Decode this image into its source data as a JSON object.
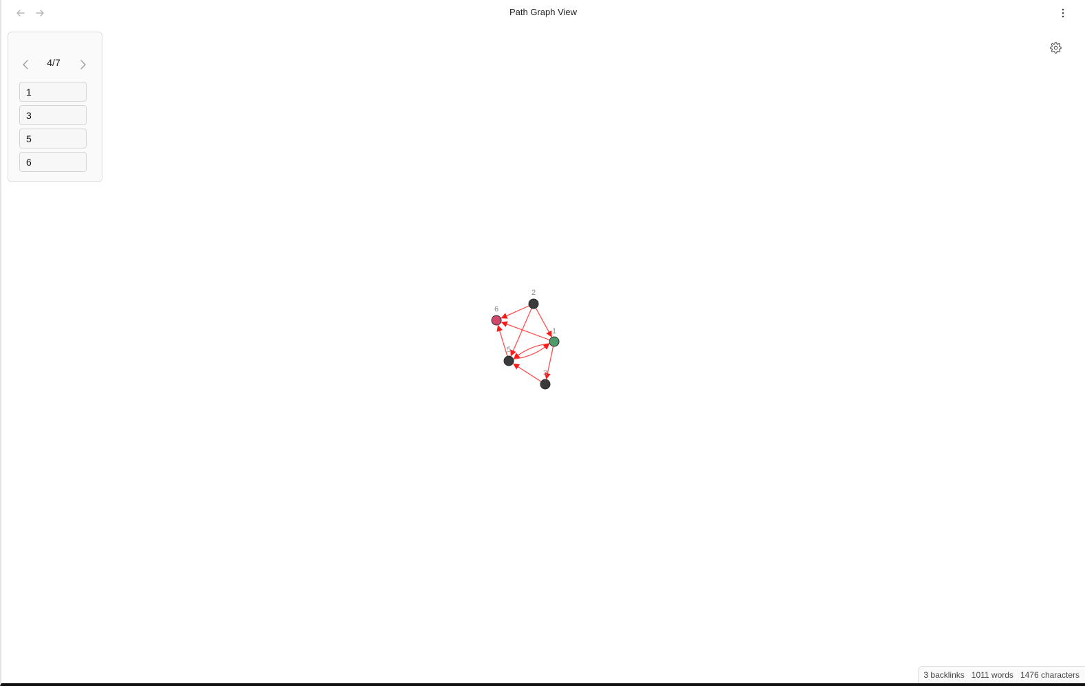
{
  "header": {
    "title": "Path Graph View"
  },
  "path_panel": {
    "pager": "4/7",
    "items": [
      {
        "label": "1"
      },
      {
        "label": "3"
      },
      {
        "label": "5"
      },
      {
        "label": "6"
      }
    ]
  },
  "graph": {
    "node_color_default": "#3a3a3a",
    "node_color_start": "#4e9a6a",
    "node_color_end": "#d0486a",
    "edge_color": "#ff4d4d",
    "label_color": "#8a8a8a",
    "nodes": [
      {
        "id": "1",
        "label": "1",
        "role": "start"
      },
      {
        "id": "2",
        "label": "2",
        "role": "default"
      },
      {
        "id": "3",
        "label": "3",
        "role": "default"
      },
      {
        "id": "5",
        "label": "5",
        "role": "default"
      },
      {
        "id": "6",
        "label": "6",
        "role": "end"
      }
    ],
    "edges": [
      {
        "from": "2",
        "to": "6"
      },
      {
        "from": "2",
        "to": "1"
      },
      {
        "from": "2",
        "to": "5"
      },
      {
        "from": "1",
        "to": "6"
      },
      {
        "from": "1",
        "to": "3"
      },
      {
        "from": "1",
        "to": "5"
      },
      {
        "from": "5",
        "to": "1"
      },
      {
        "from": "5",
        "to": "6"
      },
      {
        "from": "3",
        "to": "5"
      }
    ]
  },
  "status_bar": {
    "backlinks": "3 backlinks",
    "words": "1011 words",
    "characters": "1476 characters"
  }
}
